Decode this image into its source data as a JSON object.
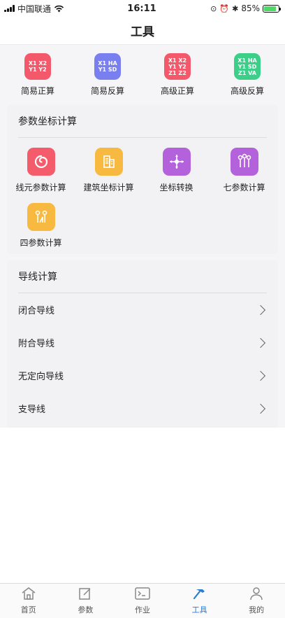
{
  "status": {
    "carrier": "中国联通",
    "time": "16:11",
    "battery": "85%",
    "battery_level": 0.85
  },
  "title": "工具",
  "quick_tools": [
    {
      "label": "简易正算",
      "color": "#f3596a",
      "icon_lines": [
        "X1 X2",
        "Y1 Y2"
      ]
    },
    {
      "label": "简易反算",
      "color": "#7a7ff0",
      "icon_lines": [
        "X1 HA",
        "Y1 SD"
      ]
    },
    {
      "label": "高级正算",
      "color": "#f3596a",
      "icon_lines": [
        "X1 X2",
        "Y1 Y2",
        "Z1 Z2"
      ]
    },
    {
      "label": "高级反算",
      "color": "#3ccf8a",
      "icon_lines": [
        "X1 HA",
        "Y1 SD",
        "Z1 VA"
      ]
    }
  ],
  "param_section": {
    "title": "参数坐标计算",
    "items": [
      {
        "label": "线元参数计算",
        "color": "#f45c6c",
        "icon": "spiral-icon"
      },
      {
        "label": "建筑坐标计算",
        "color": "#f8b940",
        "icon": "building-icon"
      },
      {
        "label": "坐标转换",
        "color": "#b462dc",
        "icon": "crosshair-icon"
      },
      {
        "label": "七参数计算",
        "color": "#b462dc",
        "icon": "pins-icon"
      },
      {
        "label": "四参数计算",
        "color": "#f8b940",
        "icon": "pins-four-icon"
      }
    ]
  },
  "traverse_section": {
    "title": "导线计算",
    "items": [
      "闭合导线",
      "附合导线",
      "无定向导线",
      "支导线"
    ]
  },
  "tabs": [
    {
      "label": "首页",
      "icon": "home-icon",
      "active": false
    },
    {
      "label": "参数",
      "icon": "edit-icon",
      "active": false
    },
    {
      "label": "作业",
      "icon": "terminal-icon",
      "active": false
    },
    {
      "label": "工具",
      "icon": "hammer-icon",
      "active": true
    },
    {
      "label": "我的",
      "icon": "user-icon",
      "active": false
    }
  ],
  "colors": {
    "accent": "#2b7cd3",
    "background": "#f5f5f7"
  }
}
